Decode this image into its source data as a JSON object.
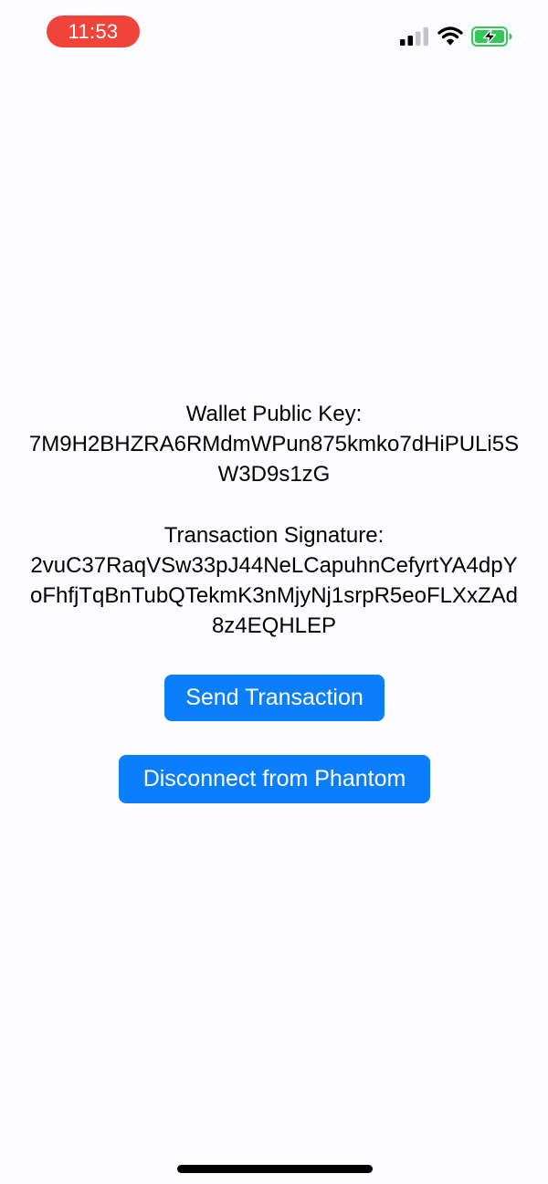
{
  "status_bar": {
    "time": "11:53",
    "time_pill_color": "#f0433a",
    "icons": [
      "signal-icon",
      "wifi-icon",
      "battery-charging-icon"
    ],
    "battery_color": "#34c759",
    "cellular_bars_active": 2,
    "cellular_bars_total": 4
  },
  "wallet": {
    "label": "Wallet Public Key:",
    "value": "7M9H2BHZRA6RMdmWPun875kmko7dHiPULi5SW3D9s1zG"
  },
  "transaction": {
    "label": "Transaction Signature:",
    "value": "2vuC37RaqVSw33pJ44NeLCapuhnCefyrtYA4dpYoFhfjTqBnTubQTekmK3nMjyNj1srpR5eoFLXxZAd8z4EQHLEP"
  },
  "buttons": {
    "send_label": "Send Transaction",
    "disconnect_label": "Disconnect from Phantom",
    "color": "#0a7efb"
  }
}
